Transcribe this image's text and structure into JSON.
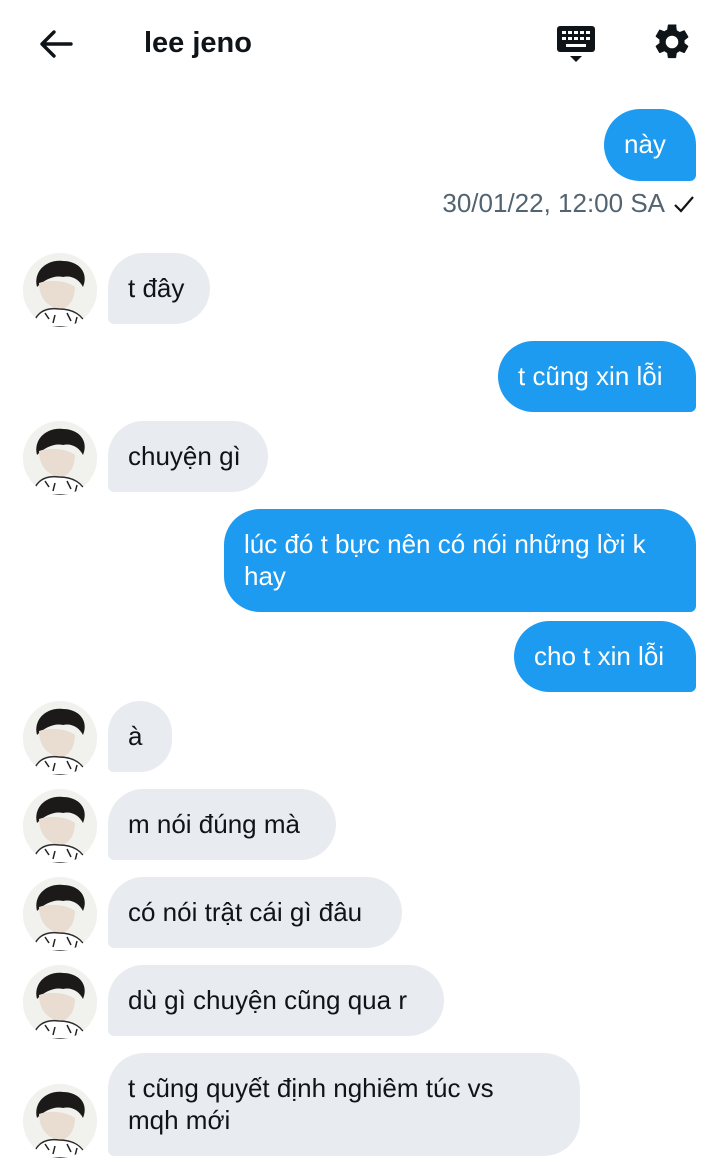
{
  "header": {
    "title": "lee jeno",
    "back_icon": "arrow-left-icon",
    "keyboard_icon": "keyboard-icon",
    "settings_icon": "gear-icon"
  },
  "colors": {
    "outgoing": "#1d9bf0",
    "incoming": "#e8ecf0",
    "muted": "#536471"
  },
  "messages": [
    {
      "from": "me",
      "text": "này"
    },
    {
      "from": "them",
      "text": "t đây"
    },
    {
      "from": "me",
      "text": "t cũng xin lỗi"
    },
    {
      "from": "them",
      "text": "chuyện gì"
    },
    {
      "from": "me",
      "text": "lúc đó t bực nên có nói những lời k\nhay"
    },
    {
      "from": "me",
      "text": "cho t xin lỗi"
    },
    {
      "from": "them",
      "text": "à"
    },
    {
      "from": "them",
      "text": "m nói đúng mà"
    },
    {
      "from": "them",
      "text": "có nói trật cái gì đâu"
    },
    {
      "from": "them",
      "text": "dù gì chuyện cũng qua r"
    },
    {
      "from": "them",
      "text": "t cũng quyết định nghiêm túc vs\nmqh mới"
    }
  ],
  "timestamp": {
    "text": "30/01/22, 12:00 SA",
    "status_icon": "checkmark-icon"
  }
}
